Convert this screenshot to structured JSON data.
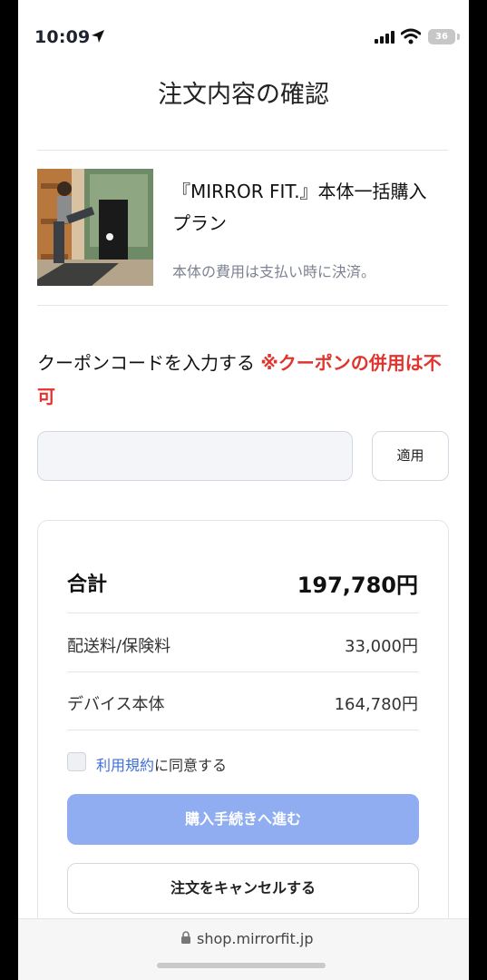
{
  "status_bar": {
    "time": "10:09",
    "battery": "36"
  },
  "page": {
    "title": "注文内容の確認"
  },
  "product": {
    "title": "『MIRROR FIT.』本体一括購入プラン",
    "description": "本体の費用は支払い時に決済。",
    "image_icon": "product-photo"
  },
  "coupon": {
    "heading": "クーポンコードを入力する",
    "note": "※クーポンの併用は不可",
    "input_value": "",
    "input_placeholder": "",
    "apply_label": "適用"
  },
  "summary": {
    "total_label": "合計",
    "total_value": "197,780円",
    "rows": [
      {
        "label": "配送料/保険料",
        "value": "33,000円"
      },
      {
        "label": "デバイス本体",
        "value": "164,780円"
      }
    ],
    "terms_link": "利用規約",
    "terms_suffix": "に同意する",
    "terms_checked": false,
    "purchase_label": "購入手続きへ進む",
    "cancel_label": "注文をキャンセルする"
  },
  "browser": {
    "url": "shop.mirrorfit.jp",
    "lock_icon": "lock-icon"
  },
  "colors": {
    "accent": "#8fadf0",
    "link": "#3f6fd6",
    "warning": "#e1342e"
  }
}
